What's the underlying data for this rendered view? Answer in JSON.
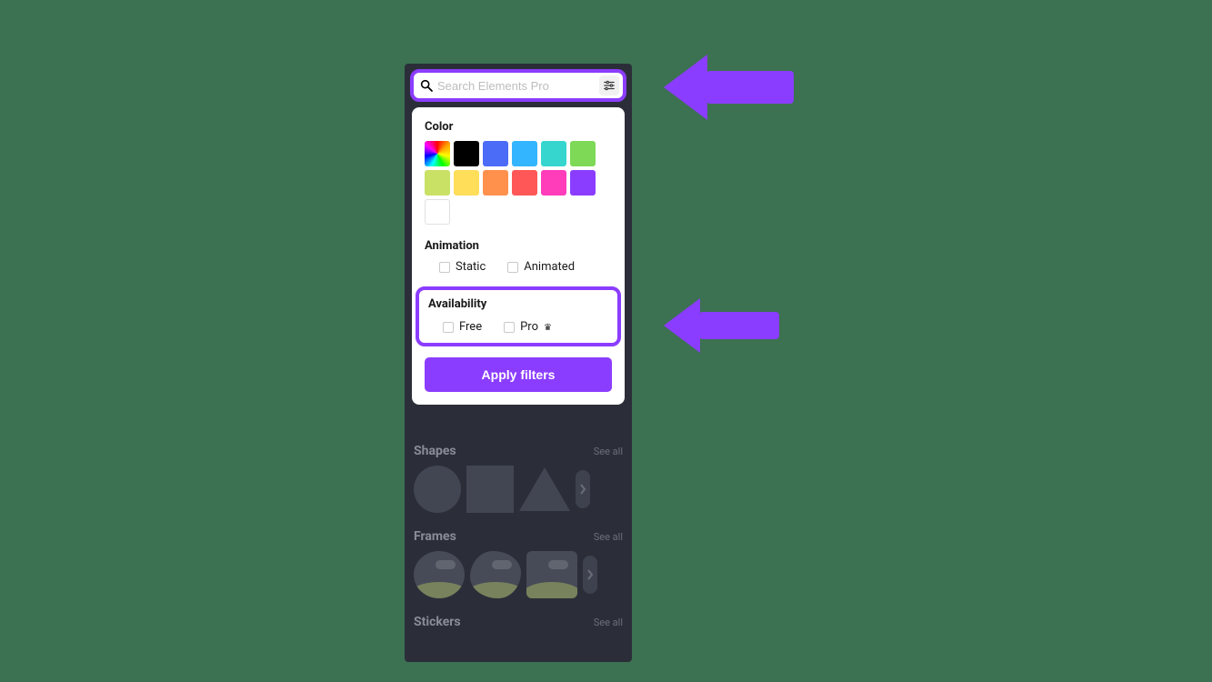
{
  "search": {
    "placeholder": "Search Elements Pro"
  },
  "filters": {
    "color": {
      "title": "Color",
      "swatches": [
        "rainbow",
        "#000000",
        "#4a6cf7",
        "#33b5ff",
        "#36d6cf",
        "#7ed957",
        "#c9e265",
        "#ffde59",
        "#ff914d",
        "#ff5757",
        "#ff3dbb",
        "#8b3dff",
        "#ffffff"
      ]
    },
    "animation": {
      "title": "Animation",
      "options": {
        "static": "Static",
        "animated": "Animated"
      }
    },
    "availability": {
      "title": "Availability",
      "options": {
        "free": "Free",
        "pro": "Pro"
      }
    },
    "apply_label": "Apply filters"
  },
  "categories": {
    "see_all": "See all",
    "shapes": "Shapes",
    "frames": "Frames",
    "stickers": "Stickers"
  },
  "accent_color": "#8b3dff"
}
